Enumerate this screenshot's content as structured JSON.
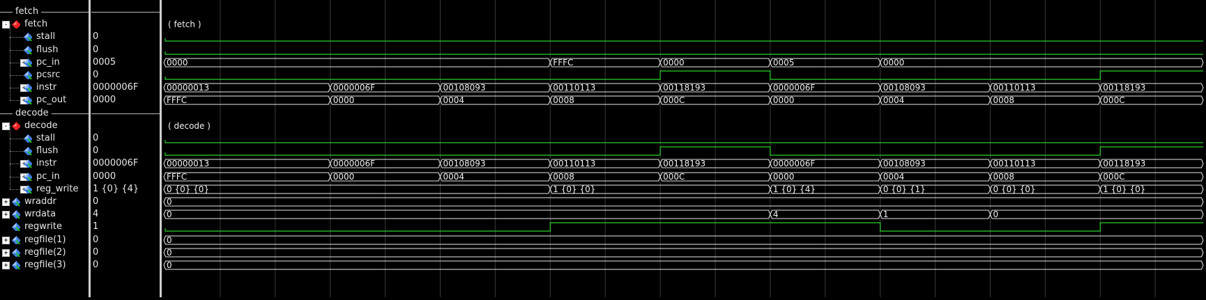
{
  "colors": {
    "wave": "#2bd12b",
    "grid": "#3a3a3a",
    "text": "#e8e8e8",
    "bus": "#e8e8e8"
  },
  "time": {
    "start": 0,
    "end": 19,
    "grid_step": 1
  },
  "rows": [
    {
      "kind": "divider",
      "label": "fetch"
    },
    {
      "kind": "group",
      "name": "fetch",
      "value": "",
      "wave_label": "( fetch )",
      "expand": "-",
      "icon": "red",
      "indent": 0
    },
    {
      "kind": "bit",
      "name": "stall",
      "value": "0",
      "indent": 1,
      "wave": [
        [
          0,
          0
        ]
      ]
    },
    {
      "kind": "bit",
      "name": "flush",
      "value": "0",
      "indent": 1,
      "wave": [
        [
          0,
          0
        ]
      ]
    },
    {
      "kind": "bus",
      "name": "pc_in",
      "value": "0005",
      "expand": "+",
      "indent": 1,
      "segs": [
        [
          0,
          "0000"
        ],
        [
          7,
          "FFFC"
        ],
        [
          9,
          "0000"
        ],
        [
          11,
          "0005"
        ],
        [
          13,
          "0000"
        ]
      ]
    },
    {
      "kind": "bit",
      "name": "pcsrc",
      "value": "0",
      "indent": 1,
      "wave": [
        [
          0,
          0
        ],
        [
          9,
          1
        ],
        [
          11,
          0
        ],
        [
          17,
          1
        ]
      ]
    },
    {
      "kind": "bus",
      "name": "instr",
      "value": "0000006F",
      "expand": "+",
      "indent": 1,
      "segs": [
        [
          0,
          "00000013"
        ],
        [
          3,
          "0000006F"
        ],
        [
          5,
          "00108093"
        ],
        [
          7,
          "00110113"
        ],
        [
          9,
          "00118193"
        ],
        [
          11,
          "0000006F"
        ],
        [
          13,
          "00108093"
        ],
        [
          15,
          "00110113"
        ],
        [
          17,
          "00118193"
        ]
      ]
    },
    {
      "kind": "bus",
      "name": "pc_out",
      "value": "0000",
      "expand": "+",
      "indent": 1,
      "segs": [
        [
          0,
          "FFFC"
        ],
        [
          3,
          "0000"
        ],
        [
          5,
          "0004"
        ],
        [
          7,
          "0008"
        ],
        [
          9,
          "000C"
        ],
        [
          11,
          "0000"
        ],
        [
          13,
          "0004"
        ],
        [
          15,
          "0008"
        ],
        [
          17,
          "000C"
        ]
      ]
    },
    {
      "kind": "divider",
      "label": "decode"
    },
    {
      "kind": "group",
      "name": "decode",
      "value": "",
      "wave_label": "( decode )",
      "expand": "-",
      "icon": "red",
      "indent": 0
    },
    {
      "kind": "bit",
      "name": "stall",
      "value": "0",
      "indent": 1,
      "wave": [
        [
          0,
          0
        ]
      ]
    },
    {
      "kind": "bit",
      "name": "flush",
      "value": "0",
      "indent": 1,
      "wave": [
        [
          0,
          0
        ],
        [
          9,
          1
        ],
        [
          11,
          0
        ],
        [
          17,
          1
        ]
      ]
    },
    {
      "kind": "bus",
      "name": "instr",
      "value": "0000006F",
      "expand": "+",
      "indent": 1,
      "segs": [
        [
          0,
          "00000013"
        ],
        [
          3,
          "0000006F"
        ],
        [
          5,
          "00108093"
        ],
        [
          7,
          "00110113"
        ],
        [
          9,
          "00118193"
        ],
        [
          11,
          "0000006F"
        ],
        [
          13,
          "00108093"
        ],
        [
          15,
          "00110113"
        ],
        [
          17,
          "00118193"
        ]
      ]
    },
    {
      "kind": "bus",
      "name": "pc_in",
      "value": "0000",
      "expand": "+",
      "indent": 1,
      "segs": [
        [
          0,
          "FFFC"
        ],
        [
          3,
          "0000"
        ],
        [
          5,
          "0004"
        ],
        [
          7,
          "0008"
        ],
        [
          9,
          "000C"
        ],
        [
          11,
          "0000"
        ],
        [
          13,
          "0004"
        ],
        [
          15,
          "0008"
        ],
        [
          17,
          "000C"
        ]
      ]
    },
    {
      "kind": "bus",
      "name": "reg_write",
      "value": "1 {0} {4}",
      "expand": "+",
      "indent": 1,
      "segs": [
        [
          0,
          "0 {0} {0}"
        ],
        [
          7,
          "1 {0} {0}"
        ],
        [
          11,
          "1 {0} {4}"
        ],
        [
          13,
          "0 {0} {1}"
        ],
        [
          15,
          "0 {0} {0}"
        ],
        [
          17,
          "1 {0} {0}"
        ]
      ]
    },
    {
      "kind": "bus",
      "name": "wraddr",
      "value": "0",
      "expand": "+",
      "indent": 0,
      "segs": [
        [
          0,
          "0"
        ]
      ]
    },
    {
      "kind": "bus",
      "name": "wrdata",
      "value": "4",
      "expand": "+",
      "indent": 0,
      "segs": [
        [
          0,
          "0"
        ],
        [
          11,
          "4"
        ],
        [
          13,
          "1"
        ],
        [
          15,
          "0"
        ]
      ]
    },
    {
      "kind": "bit",
      "name": "regwrite",
      "value": "1",
      "indent": 0,
      "wave": [
        [
          0,
          0
        ],
        [
          7,
          1
        ],
        [
          13,
          0
        ],
        [
          17,
          1
        ]
      ]
    },
    {
      "kind": "bus",
      "name": "regfile(1)",
      "value": "0",
      "expand": "+",
      "indent": 0,
      "segs": [
        [
          0,
          "0"
        ]
      ]
    },
    {
      "kind": "bus",
      "name": "regfile(2)",
      "value": "0",
      "expand": "+",
      "indent": 0,
      "segs": [
        [
          0,
          "0"
        ]
      ]
    },
    {
      "kind": "bus",
      "name": "regfile(3)",
      "value": "0",
      "expand": "+",
      "indent": 0,
      "segs": [
        [
          0,
          "0"
        ]
      ]
    }
  ]
}
